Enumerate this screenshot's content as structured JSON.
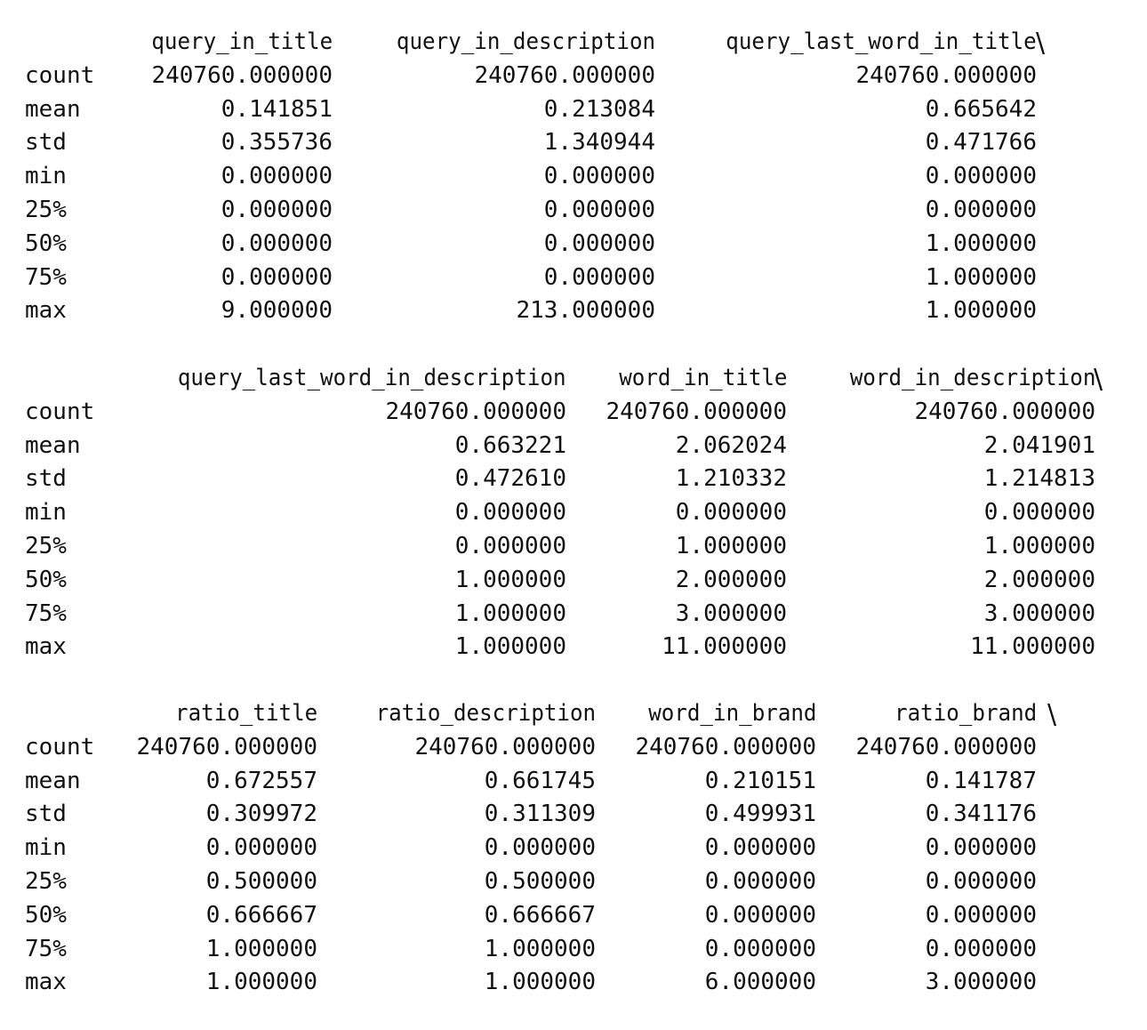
{
  "row_labels": [
    "count",
    "mean",
    "std",
    "min",
    "25%",
    "50%",
    "75%",
    "max"
  ],
  "continuation_mark": "\\",
  "blocks": [
    {
      "columns": [
        {
          "name": "query_in_title",
          "values": [
            "240760.000000",
            "0.141851",
            "0.355736",
            "0.000000",
            "0.000000",
            "0.000000",
            "0.000000",
            "9.000000"
          ]
        },
        {
          "name": "query_in_description",
          "values": [
            "240760.000000",
            "0.213084",
            "1.340944",
            "0.000000",
            "0.000000",
            "0.000000",
            "0.000000",
            "213.000000"
          ]
        },
        {
          "name": "query_last_word_in_title",
          "values": [
            "240760.000000",
            "0.665642",
            "0.471766",
            "0.000000",
            "0.000000",
            "1.000000",
            "1.000000",
            "1.000000"
          ]
        }
      ]
    },
    {
      "columns": [
        {
          "name": "query_last_word_in_description",
          "values": [
            "240760.000000",
            "0.663221",
            "0.472610",
            "0.000000",
            "0.000000",
            "1.000000",
            "1.000000",
            "1.000000"
          ]
        },
        {
          "name": "word_in_title",
          "values": [
            "240760.000000",
            "2.062024",
            "1.210332",
            "0.000000",
            "1.000000",
            "2.000000",
            "3.000000",
            "11.000000"
          ]
        },
        {
          "name": "word_in_description",
          "values": [
            "240760.000000",
            "2.041901",
            "1.214813",
            "0.000000",
            "1.000000",
            "2.000000",
            "3.000000",
            "11.000000"
          ]
        }
      ]
    },
    {
      "columns": [
        {
          "name": "ratio_title",
          "values": [
            "240760.000000",
            "0.672557",
            "0.309972",
            "0.000000",
            "0.500000",
            "0.666667",
            "1.000000",
            "1.000000"
          ]
        },
        {
          "name": "ratio_description",
          "values": [
            "240760.000000",
            "0.661745",
            "0.311309",
            "0.000000",
            "0.500000",
            "0.666667",
            "1.000000",
            "1.000000"
          ]
        },
        {
          "name": "word_in_brand",
          "values": [
            "240760.000000",
            "0.210151",
            "0.499931",
            "0.000000",
            "0.000000",
            "0.000000",
            "0.000000",
            "6.000000"
          ]
        },
        {
          "name": "ratio_brand",
          "values": [
            "240760.000000",
            "0.141787",
            "0.341176",
            "0.000000",
            "0.000000",
            "0.000000",
            "0.000000",
            "3.000000"
          ]
        }
      ]
    }
  ]
}
